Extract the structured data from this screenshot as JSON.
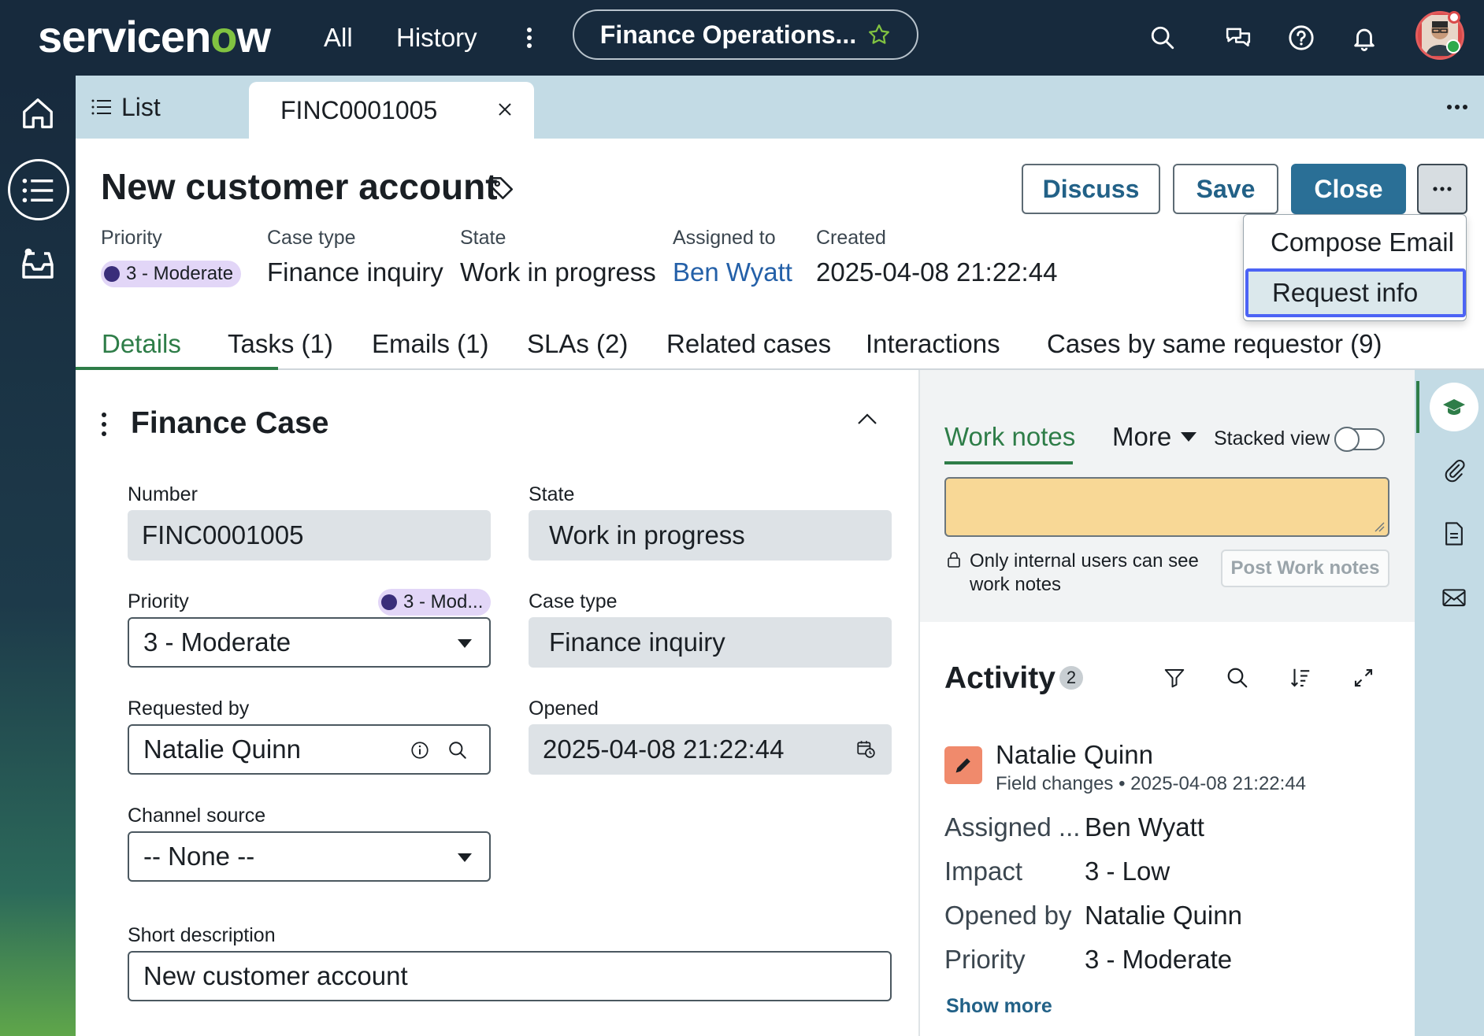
{
  "header": {
    "logo_text_a": "servicen",
    "logo_text_o": "o",
    "logo_text_b": "w",
    "nav_all": "All",
    "nav_history": "History",
    "workspace": "Finance Operations..."
  },
  "tabs": {
    "list_label": "List",
    "record_label": "FINC0001005"
  },
  "record": {
    "title": "New customer account",
    "actions": {
      "discuss": "Discuss",
      "save": "Save",
      "close": "Close",
      "more": "..."
    },
    "menu": {
      "compose_email": "Compose Email",
      "request_info": "Request info"
    },
    "meta": {
      "priority_label": "Priority",
      "priority_value": "3 - Moderate",
      "case_type_label": "Case type",
      "case_type_value": "Finance inquiry",
      "state_label": "State",
      "state_value": "Work in progress",
      "assigned_label": "Assigned to",
      "assigned_value": "Ben Wyatt",
      "created_label": "Created",
      "created_value": "2025-04-08 21:22:44"
    },
    "tabs": [
      "Details",
      "Tasks (1)",
      "Emails (1)",
      "SLAs (2)",
      "Related cases",
      "Interactions",
      "Cases by same requestor (9)"
    ]
  },
  "form": {
    "section_title": "Finance Case",
    "number_label": "Number",
    "number_value": "FINC0001005",
    "state_label": "State",
    "state_value": "Work in progress",
    "priority_label": "Priority",
    "priority_pill": "3 - Mod...",
    "priority_value": "3 - Moderate",
    "case_type_label": "Case type",
    "case_type_value": "Finance inquiry",
    "requested_by_label": "Requested by",
    "requested_by_value": "Natalie Quinn",
    "opened_label": "Opened",
    "opened_value": "2025-04-08 21:22:44",
    "channel_label": "Channel source",
    "channel_value": "-- None --",
    "short_desc_label": "Short description",
    "short_desc_value": "New customer account"
  },
  "work_notes": {
    "tab": "Work notes",
    "more": "More",
    "stacked_view": "Stacked view",
    "hint": "Only internal users can see work notes",
    "post_button": "Post Work notes"
  },
  "activity": {
    "title": "Activity",
    "count": "2",
    "author": "Natalie Quinn",
    "subtitle": "Field changes • 2025-04-08 21:22:44",
    "rows": [
      {
        "label": "Assigned ...",
        "value": "Ben Wyatt"
      },
      {
        "label": "Impact",
        "value": "3 - Low"
      },
      {
        "label": "Opened by",
        "value": "Natalie Quinn"
      },
      {
        "label": "Priority",
        "value": "3 - Moderate"
      }
    ],
    "show_more": "Show more"
  },
  "colors": {
    "header_bg": "#172a3d",
    "accent_green": "#2e7d48",
    "primary_button": "#2a6f96",
    "work_notes_bg": "#f8d896",
    "menu_focus": "#4c63f5"
  },
  "icons": {
    "top": [
      "search-icon",
      "chat-icon",
      "help-icon",
      "bell-icon"
    ],
    "rail": [
      "home-icon",
      "list-icon",
      "inbox-icon"
    ],
    "side": [
      "learning-icon",
      "attachment-icon",
      "document-icon",
      "email-icon"
    ]
  }
}
